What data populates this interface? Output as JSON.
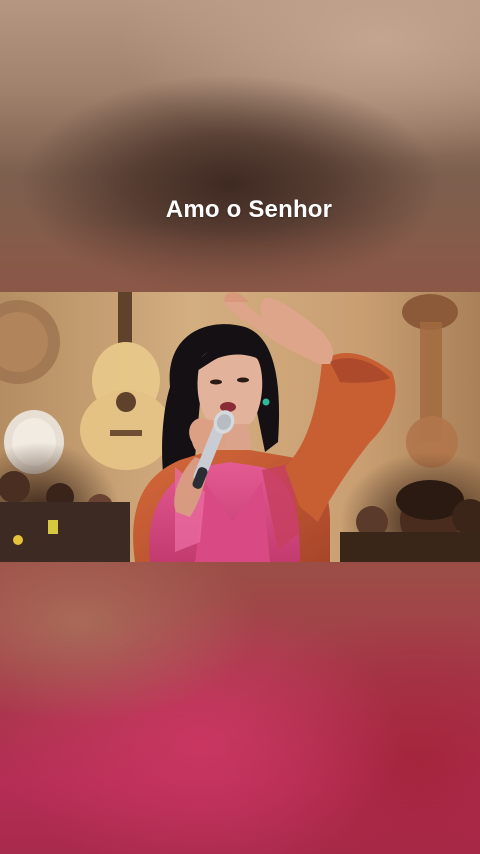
{
  "video": {
    "caption": "Amo o Senhor"
  },
  "colors": {
    "caption_text": "#ffffff",
    "top_backdrop": "#a1826d",
    "bottom_backdrop": "#b52d55",
    "performer_outfit": "#d8457a",
    "jacket": "#c25a30"
  }
}
